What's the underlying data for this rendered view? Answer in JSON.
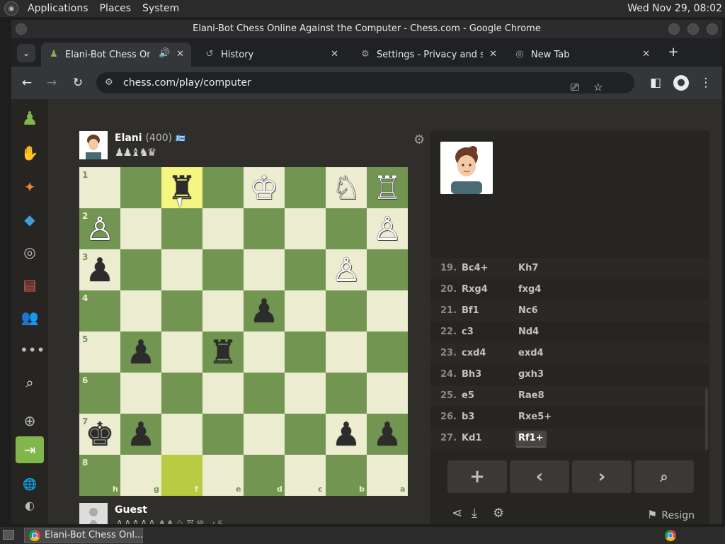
{
  "system_panel": {
    "menus": [
      "Applications",
      "Places",
      "System"
    ],
    "clock": "Wed Nov 29, 08:02"
  },
  "window": {
    "title": "Elani-Bot Chess Online Against the Computer - Chess.com - Google Chrome"
  },
  "tabs": [
    {
      "label": "Elani-Bot Chess Onlin",
      "icon": "chess-pawn-icon",
      "active": true,
      "audio": true
    },
    {
      "label": "History",
      "icon": "history-icon"
    },
    {
      "label": "Settings - Privacy and secu",
      "icon": "gear-icon"
    },
    {
      "label": "New Tab",
      "icon": "chrome-icon"
    }
  ],
  "toolbar": {
    "url": "chess.com/play/computer"
  },
  "top_player": {
    "name": "Elani",
    "rating": "(400)",
    "flag": "🇬🇷",
    "captured": "♟♟♝♞♛"
  },
  "bottom_player": {
    "name": "Guest",
    "captured": "♙♙♙♙♙ ♗♗ ♘ ♖ ♕",
    "advantage": "+5"
  },
  "board": {
    "orientation": "black",
    "ranks": [
      "1",
      "2",
      "3",
      "4",
      "5",
      "6",
      "7",
      "8"
    ],
    "files": [
      "h",
      "g",
      "f",
      "e",
      "d",
      "c",
      "b",
      "a"
    ],
    "highlight": [
      "f1",
      "f8"
    ],
    "pieces": [
      {
        "sq": "f1",
        "glyph": "♜",
        "color": "b"
      },
      {
        "sq": "d1",
        "glyph": "♔",
        "color": "w"
      },
      {
        "sq": "b1",
        "glyph": "♘",
        "color": "w"
      },
      {
        "sq": "a1",
        "glyph": "♖",
        "color": "w"
      },
      {
        "sq": "h2",
        "glyph": "♙",
        "color": "w"
      },
      {
        "sq": "a2",
        "glyph": "♙",
        "color": "w"
      },
      {
        "sq": "h3",
        "glyph": "♟",
        "color": "b"
      },
      {
        "sq": "b3",
        "glyph": "♙",
        "color": "w"
      },
      {
        "sq": "d4",
        "glyph": "♟",
        "color": "b"
      },
      {
        "sq": "g5",
        "glyph": "♟",
        "color": "b"
      },
      {
        "sq": "e5",
        "glyph": "♜",
        "color": "b"
      },
      {
        "sq": "h7",
        "glyph": "♚",
        "color": "b"
      },
      {
        "sq": "g7",
        "glyph": "♟",
        "color": "b"
      },
      {
        "sq": "b7",
        "glyph": "♟",
        "color": "b"
      },
      {
        "sq": "a7",
        "glyph": "♟",
        "color": "b"
      }
    ]
  },
  "moves": [
    {
      "num": "19.",
      "white": "Bc4+",
      "black": "Kh7"
    },
    {
      "num": "20.",
      "white": "Rxg4",
      "black": "fxg4"
    },
    {
      "num": "21.",
      "white": "Bf1",
      "black": "Nc6"
    },
    {
      "num": "22.",
      "white": "c3",
      "black": "Nd4"
    },
    {
      "num": "23.",
      "white": "cxd4",
      "black": "exd4"
    },
    {
      "num": "24.",
      "white": "Bh3",
      "black": "gxh3"
    },
    {
      "num": "25.",
      "white": "e5",
      "black": "Rae8"
    },
    {
      "num": "26.",
      "white": "b3",
      "black": "Rxe5+"
    },
    {
      "num": "27.",
      "white": "Kd1",
      "black": "Rf1+",
      "current": true
    }
  ],
  "controls": {
    "add": "+",
    "prev": "‹",
    "next": "›",
    "analyze": "analysis-icon",
    "resign": "Resign"
  },
  "taskbar": {
    "task_label": "Elani-Bot Chess Onl..."
  },
  "colors": {
    "light_square": "#ebecd0",
    "dark_square": "#739552",
    "highlight_light": "#f5f682",
    "highlight_dark": "#b9ca43",
    "brand_green": "#81b64c"
  }
}
